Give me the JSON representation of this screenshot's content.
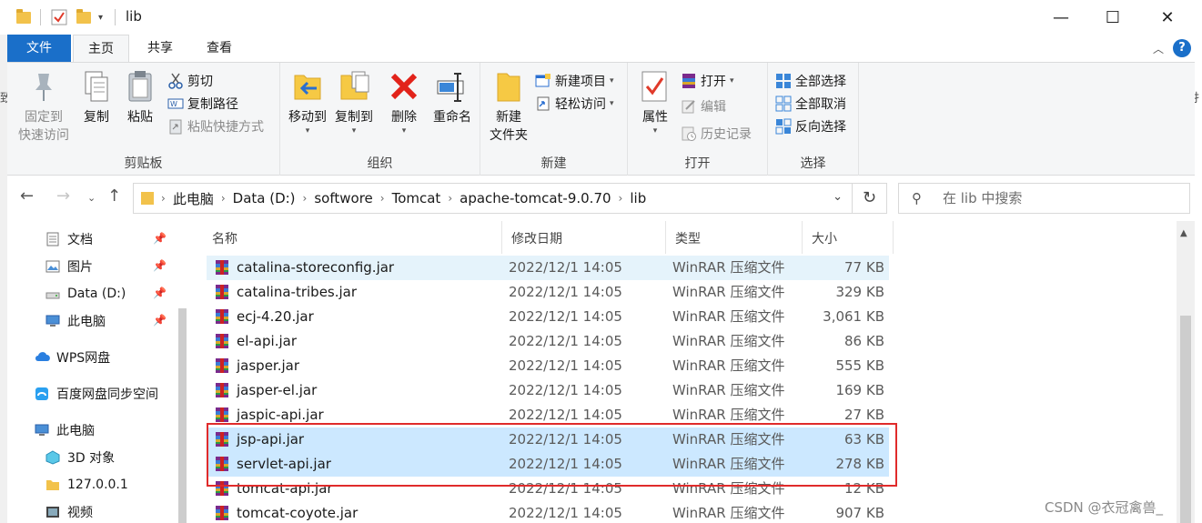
{
  "window": {
    "title": "lib",
    "minimize": "—",
    "maximize": "☐",
    "close": "✕"
  },
  "tabs": {
    "file": "文件",
    "home": "主页",
    "share": "共享",
    "view": "查看"
  },
  "ribbon": {
    "clipboard": {
      "label": "剪贴板",
      "pin": "固定到\n快速访问",
      "pin_l1": "固定到",
      "pin_l2": "快速访问",
      "copy": "复制",
      "paste": "粘贴",
      "cut": "剪切",
      "copy_path": "复制路径",
      "paste_shortcut": "粘贴快捷方式"
    },
    "organize": {
      "label": "组织",
      "move_to": "移动到",
      "copy_to": "复制到",
      "delete": "删除",
      "rename": "重命名"
    },
    "new": {
      "label": "新建",
      "new_folder_l1": "新建",
      "new_folder_l2": "文件夹",
      "new_item": "新建项目",
      "easy_access": "轻松访问"
    },
    "open": {
      "label": "打开",
      "properties": "属性",
      "open": "打开",
      "edit": "编辑",
      "history": "历史记录"
    },
    "select": {
      "label": "选择",
      "select_all": "全部选择",
      "select_none": "全部取消",
      "invert": "反向选择"
    }
  },
  "breadcrumb": [
    "此电脑",
    "Data (D:)",
    "softwore",
    "Tomcat",
    "apache-tomcat-9.0.70",
    "lib"
  ],
  "search": {
    "placeholder": "在 lib 中搜索"
  },
  "nav": [
    {
      "label": "文档",
      "pinned": true
    },
    {
      "label": "图片",
      "pinned": true
    },
    {
      "label": "Data (D:)",
      "pinned": true
    },
    {
      "label": "此电脑",
      "pinned": true
    },
    {
      "label": "WPS网盘",
      "pinned": false
    },
    {
      "label": "百度网盘同步空间",
      "pinned": false
    },
    {
      "label": "此电脑",
      "pinned": false
    },
    {
      "label": "3D 对象",
      "pinned": false
    },
    {
      "label": "127.0.0.1",
      "pinned": false
    },
    {
      "label": "视频",
      "pinned": false
    }
  ],
  "columns": {
    "name": "名称",
    "date": "修改日期",
    "type": "类型",
    "size": "大小"
  },
  "files": [
    {
      "name": "catalina-storeconfig.jar",
      "date": "2022/12/1 14:05",
      "type": "WinRAR 压缩文件",
      "size": "77 KB",
      "state": "hover"
    },
    {
      "name": "catalina-tribes.jar",
      "date": "2022/12/1 14:05",
      "type": "WinRAR 压缩文件",
      "size": "329 KB",
      "state": ""
    },
    {
      "name": "ecj-4.20.jar",
      "date": "2022/12/1 14:05",
      "type": "WinRAR 压缩文件",
      "size": "3,061 KB",
      "state": ""
    },
    {
      "name": "el-api.jar",
      "date": "2022/12/1 14:05",
      "type": "WinRAR 压缩文件",
      "size": "86 KB",
      "state": ""
    },
    {
      "name": "jasper.jar",
      "date": "2022/12/1 14:05",
      "type": "WinRAR 压缩文件",
      "size": "555 KB",
      "state": ""
    },
    {
      "name": "jasper-el.jar",
      "date": "2022/12/1 14:05",
      "type": "WinRAR 压缩文件",
      "size": "169 KB",
      "state": ""
    },
    {
      "name": "jaspic-api.jar",
      "date": "2022/12/1 14:05",
      "type": "WinRAR 压缩文件",
      "size": "27 KB",
      "state": ""
    },
    {
      "name": "jsp-api.jar",
      "date": "2022/12/1 14:05",
      "type": "WinRAR 压缩文件",
      "size": "63 KB",
      "state": "sel"
    },
    {
      "name": "servlet-api.jar",
      "date": "2022/12/1 14:05",
      "type": "WinRAR 压缩文件",
      "size": "278 KB",
      "state": "sel"
    },
    {
      "name": "tomcat-api.jar",
      "date": "2022/12/1 14:05",
      "type": "WinRAR 压缩文件",
      "size": "12 KB",
      "state": ""
    },
    {
      "name": "tomcat-coyote.jar",
      "date": "2022/12/1 14:05",
      "type": "WinRAR 压缩文件",
      "size": "907 KB",
      "state": ""
    }
  ],
  "edge": {
    "left": "致",
    "right": "扌"
  },
  "watermark": "CSDN @衣冠禽兽_",
  "colors": {
    "accent": "#1a6fc9",
    "selection": "#cce8ff",
    "hover": "#e5f3fb",
    "highlight": "#e02b2b"
  }
}
